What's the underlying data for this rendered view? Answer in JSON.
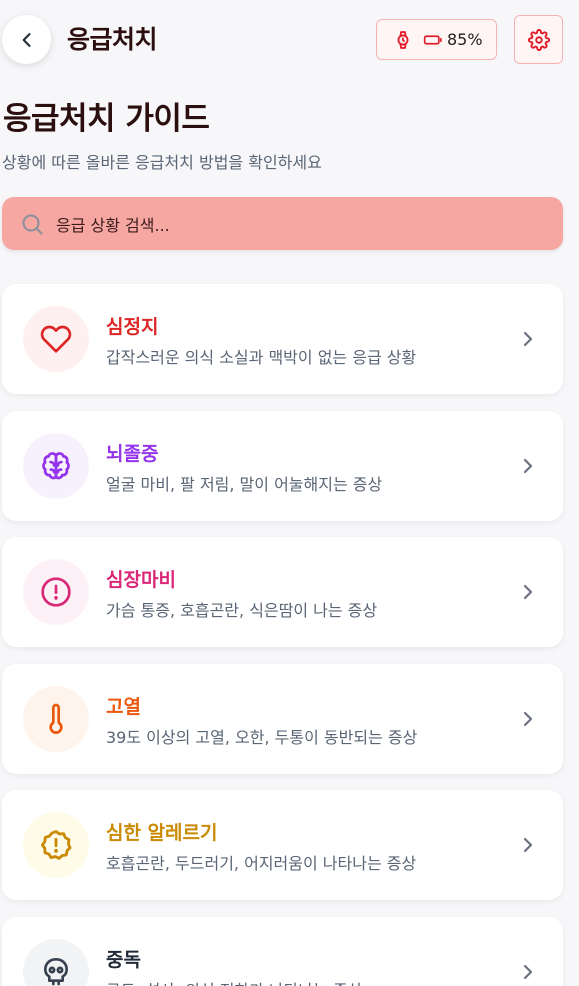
{
  "header": {
    "title": "응급처치",
    "battery": "85%",
    "colors": {
      "accent": "#e11d2a",
      "device_bg": "#fff5f5"
    }
  },
  "page": {
    "title": "응급처치 가이드",
    "subtitle": "상황에 따른 올바른 응급처치 방법을 확인하세요"
  },
  "search": {
    "placeholder": "응급 상황 검색..."
  },
  "cards": [
    {
      "title": "심정지",
      "description": "갑작스러운 의식 소실과 맥박이 없는 응급 상황",
      "icon": "heart-icon",
      "color": "#dc2626",
      "bg": "#fef0f0"
    },
    {
      "title": "뇌졸중",
      "description": "얼굴 마비, 팔 저림, 말이 어눌해지는 증상",
      "icon": "brain-icon",
      "color": "#9333ea",
      "bg": "#f7f1fd"
    },
    {
      "title": "심장마비",
      "description": "가슴 통증, 호흡곤란, 식은땀이 나는 증상",
      "icon": "alert-circle-icon",
      "color": "#db2777",
      "bg": "#fdf0f6"
    },
    {
      "title": "고열",
      "description": "39도 이상의 고열, 오한, 두통이 동반되는 증상",
      "icon": "thermometer-icon",
      "color": "#ea580c",
      "bg": "#fff4ec"
    },
    {
      "title": "심한 알레르기",
      "description": "호흡곤란, 두드러기, 어지러움이 나타나는 증상",
      "icon": "alert-badge-icon",
      "color": "#ca8a04",
      "bg": "#fefbe8"
    },
    {
      "title": "중독",
      "description": "구토, 설사, 의식 저하가 나타나는 증상",
      "icon": "skull-icon",
      "color": "#374151",
      "bg": "#f2f3f5"
    }
  ]
}
